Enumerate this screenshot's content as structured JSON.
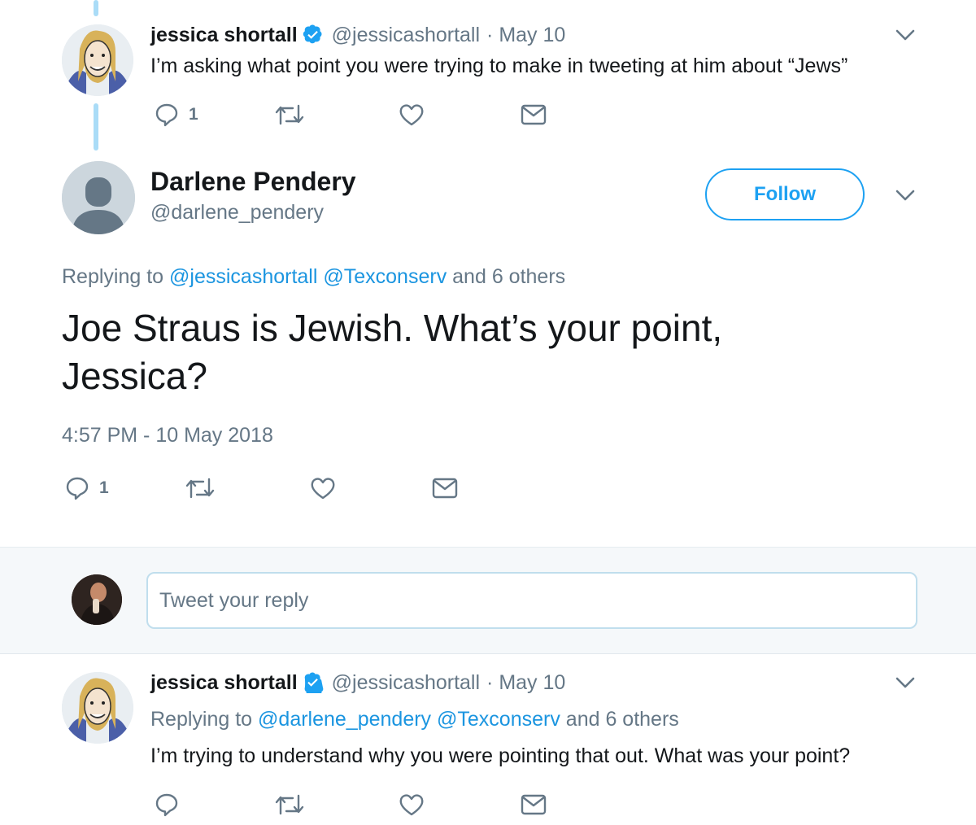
{
  "tweet1": {
    "display_name": "jessica shortall",
    "handle": "@jessicashortall",
    "date": "· May 10",
    "text": "I’m asking what point you were trying to make in tweeting at him about “Jews”",
    "reply_count": "1"
  },
  "main_tweet": {
    "display_name": "Darlene Pendery",
    "handle": "@darlene_pendery",
    "follow_label": "Follow",
    "replying_prefix": "Replying to",
    "replying_mention1": "@jessicashortall",
    "replying_mention2": "@Texconserv",
    "replying_suffix": "and 6 others",
    "text": "Joe Straus is Jewish. What’s your point, Jessica?",
    "timestamp": "4:57 PM - 10 May 2018",
    "reply_count": "1"
  },
  "reply_box": {
    "placeholder": "Tweet your reply"
  },
  "tweet3": {
    "display_name": "jessica shortall",
    "handle": "@jessicashortall",
    "date": "· May 10",
    "replying_prefix": "Replying to",
    "replying_mention1": "@darlene_pendery",
    "replying_mention2": "@Texconserv",
    "replying_suffix": "and 6 others",
    "text": "I’m trying to understand why you were pointing that out. What was your point?"
  },
  "colors": {
    "accent": "#1da1f2",
    "link": "#1b95e0",
    "muted": "#657786",
    "thread_line": "#aadcf7"
  },
  "icons": [
    "reply-icon",
    "retweet-icon",
    "like-icon",
    "message-icon",
    "chevron-down-icon",
    "verified-badge-icon"
  ]
}
